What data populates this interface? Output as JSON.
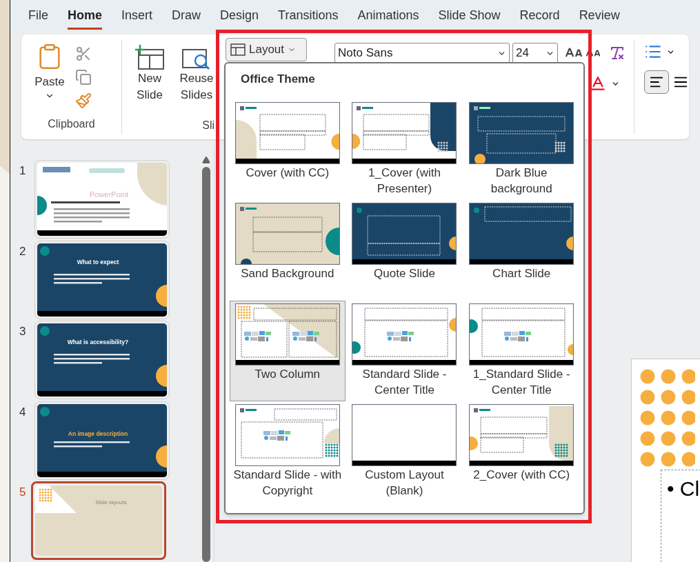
{
  "ribbon_tabs": [
    {
      "label": "File",
      "selected": false
    },
    {
      "label": "Home",
      "selected": true
    },
    {
      "label": "Insert",
      "selected": false
    },
    {
      "label": "Draw",
      "selected": false
    },
    {
      "label": "Design",
      "selected": false
    },
    {
      "label": "Transitions",
      "selected": false
    },
    {
      "label": "Animations",
      "selected": false
    },
    {
      "label": "Slide Show",
      "selected": false
    },
    {
      "label": "Record",
      "selected": false
    },
    {
      "label": "Review",
      "selected": false
    }
  ],
  "clipboard": {
    "paste": "Paste",
    "group_label": "Clipboard"
  },
  "slides_group": {
    "new_slide": "New Slide",
    "reuse_slides": "Reuse Slides",
    "group_label": "Sli",
    "layout": "Layout"
  },
  "font": {
    "name": "Noto Sans",
    "size": "24"
  },
  "slides": [
    {
      "number": "1",
      "kind": "cover",
      "title": "PowerPoint",
      "selected": false
    },
    {
      "number": "2",
      "kind": "dark",
      "title": "What to expect",
      "selected": false
    },
    {
      "number": "3",
      "kind": "dark",
      "title": "What is accessibility?",
      "selected": false
    },
    {
      "number": "4",
      "kind": "accent",
      "title": "An image description",
      "selected": false
    },
    {
      "number": "5",
      "kind": "layouts",
      "title": "Slide layouts",
      "selected": true
    }
  ],
  "layout_menu": {
    "title": "Office Theme",
    "layouts": [
      {
        "label": "Cover (with CC)",
        "kind": "cover-cc",
        "selected": false
      },
      {
        "label": "1_Cover (with Presenter)",
        "kind": "cover-presenter",
        "selected": false
      },
      {
        "label": "Dark Blue background",
        "kind": "dark-blue",
        "selected": false
      },
      {
        "label": "Sand Background",
        "kind": "sand",
        "selected": false
      },
      {
        "label": "Quote Slide",
        "kind": "quote",
        "selected": false
      },
      {
        "label": "Chart Slide",
        "kind": "chart",
        "selected": false
      },
      {
        "label": "Two Column",
        "kind": "two-column",
        "selected": true
      },
      {
        "label": "Standard Slide - Center Title",
        "kind": "center-title",
        "selected": false
      },
      {
        "label": "1_Standard Slide - Center Title",
        "kind": "center-title-alt",
        "selected": false
      },
      {
        "label": "Standard Slide - with Copyright",
        "kind": "copyright",
        "selected": false
      },
      {
        "label": "Custom Layout (Blank)",
        "kind": "blank",
        "selected": false
      },
      {
        "label": "2_Cover (with CC)",
        "kind": "cover-cc-2",
        "selected": false
      }
    ]
  },
  "canvas": {
    "bullet_text": "• Cl"
  }
}
